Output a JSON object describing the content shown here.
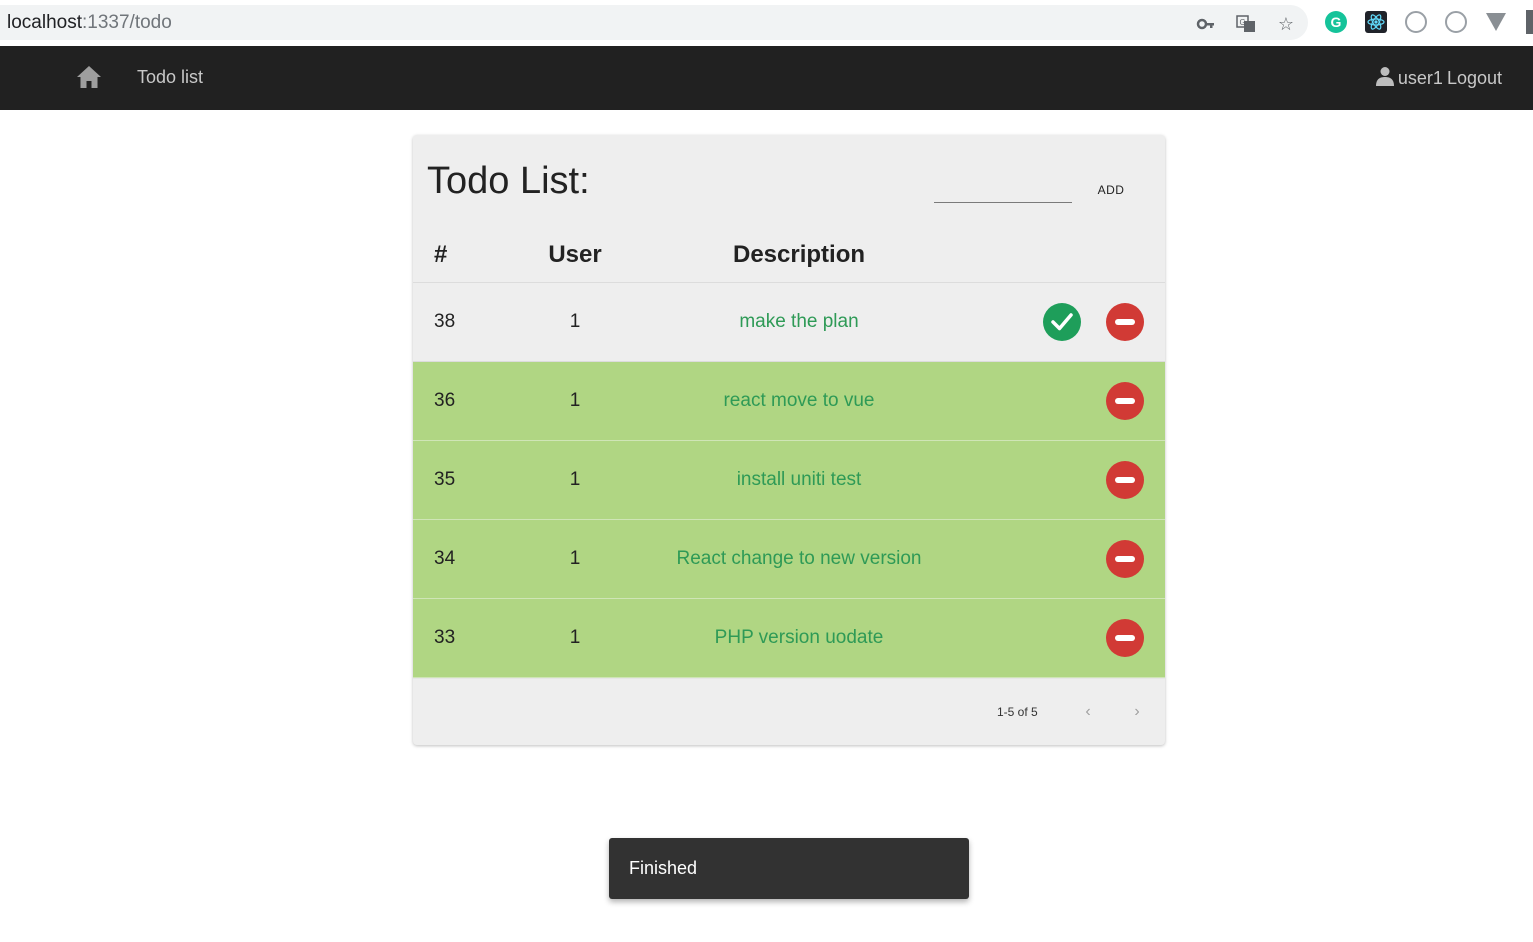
{
  "browser": {
    "url_host": "localhost",
    "url_path": ":1337/todo",
    "icons": [
      "key-icon",
      "translate-icon",
      "star-icon",
      "grammarly-extension-icon",
      "react-devtools-icon",
      "extension-icon",
      "reader-icon",
      "vue-devtools-icon"
    ]
  },
  "navbar": {
    "title": "Todo list",
    "username": "user1",
    "logout_label": "Logout",
    "background": "#212121"
  },
  "todo": {
    "heading": "Todo List:",
    "add_input_value": "",
    "add_label": "ADD",
    "columns": [
      "#",
      "User",
      "Description"
    ],
    "rows": [
      {
        "id": "38",
        "user": "1",
        "description": "make the plan",
        "status": "pending"
      },
      {
        "id": "36",
        "user": "1",
        "description": "react move to vue",
        "status": "done"
      },
      {
        "id": "35",
        "user": "1",
        "description": "install uniti test",
        "status": "done"
      },
      {
        "id": "34",
        "user": "1",
        "description": "React change to new version",
        "status": "done"
      },
      {
        "id": "33",
        "user": "1",
        "description": "PHP version uodate",
        "status": "done"
      }
    ],
    "pagination": "1-5 of 5",
    "colors": {
      "done_row": "#b0d683",
      "description_text": "#2e9a56",
      "check_button": "#1e9e5a",
      "delete_button": "#d13a35"
    }
  },
  "snackbar": {
    "message": "Finished"
  }
}
